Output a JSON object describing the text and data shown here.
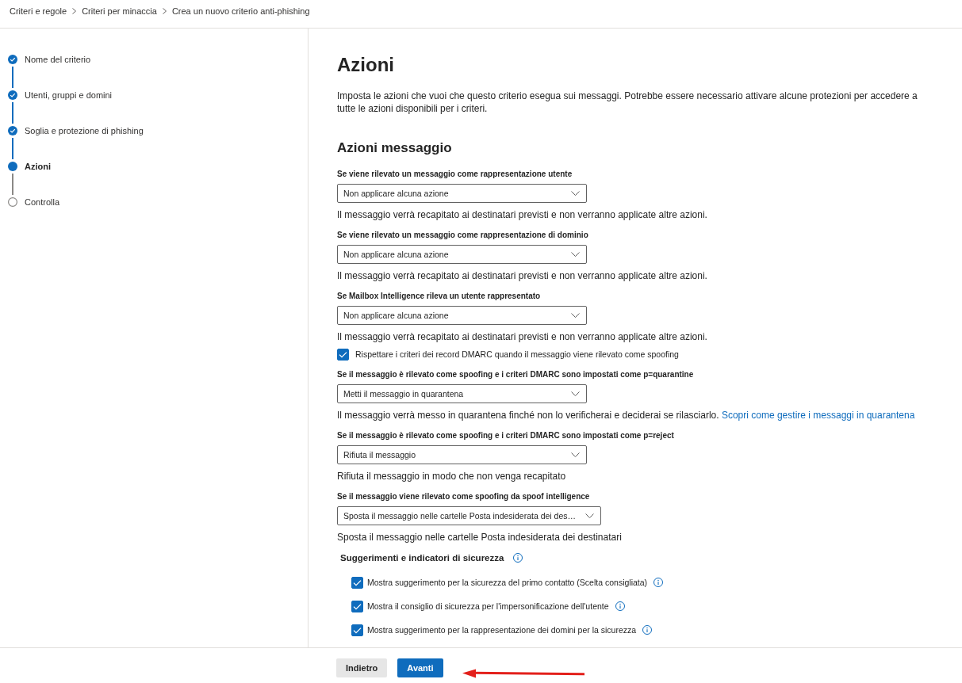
{
  "breadcrumb": [
    "Criteri e regole",
    "Criteri per minaccia",
    "Crea un nuovo criterio anti-phishing"
  ],
  "steps": [
    {
      "label": "Nome del criterio",
      "completed": true,
      "selected": false
    },
    {
      "label": "Utenti, gruppi e domini",
      "completed": true,
      "selected": false
    },
    {
      "label": "Soglia e protezione di phishing",
      "completed": true,
      "selected": false
    },
    {
      "label": "Azioni",
      "completed": false,
      "selected": true
    },
    {
      "label": "Controlla",
      "completed": false,
      "selected": false
    }
  ],
  "page": {
    "title": "Azioni",
    "description": "Imposta le azioni che vuoi che questo criterio esegua sui messaggi. Potrebbe essere necessario attivare alcune protezioni per accedere a tutte le azioni disponibili per i criteri."
  },
  "message_actions": {
    "title": "Azioni messaggio",
    "items": [
      {
        "kind": "dropdown",
        "label": "Se viene rilevato un messaggio come rappresentazione utente",
        "value": "Non applicare alcuna azione",
        "help": "Il messaggio verrà recapitato ai destinatari previsti e non verranno applicate altre azioni."
      },
      {
        "kind": "dropdown",
        "label": "Se viene rilevato un messaggio come rappresentazione di dominio",
        "value": "Non applicare alcuna azione",
        "help": "Il messaggio verrà recapitato ai destinatari previsti e non verranno applicate altre azioni."
      },
      {
        "kind": "dropdown",
        "label": "Se Mailbox Intelligence rileva un utente rappresentato",
        "value": "Non applicare alcuna azione",
        "help": "Il messaggio verrà recapitato ai destinatari previsti e non verranno applicate altre azioni."
      },
      {
        "kind": "checkbox",
        "label": "Rispettare i criteri dei record DMARC quando il messaggio viene rilevato come spoofing",
        "checked": true
      },
      {
        "kind": "dropdown",
        "label": "Se il messaggio è rilevato come spoofing e i criteri DMARC sono impostati come p=quarantine",
        "value": "Metti il messaggio in quarantena",
        "help": "Il messaggio verrà messo in quarantena finché non lo verificherai e deciderai se rilasciarlo.",
        "link": "Scopri come gestire i messaggi in quarantena"
      },
      {
        "kind": "dropdown",
        "label": "Se il messaggio è rilevato come spoofing e i criteri DMARC sono impostati come p=reject",
        "value": "Rifiuta il messaggio",
        "help": "Rifiuta il messaggio in modo che non venga recapitato"
      },
      {
        "kind": "dropdown",
        "label": "Se il messaggio viene rilevato come spoofing da spoof intelligence",
        "value": "Sposta il messaggio nelle cartelle Posta indesiderata dei des…",
        "help": "Sposta il messaggio nelle cartelle Posta indesiderata dei destinatari"
      }
    ]
  },
  "safety_tips": {
    "title": "Suggerimenti e indicatori di sicurezza",
    "items": [
      {
        "label": "Mostra suggerimento per la sicurezza del primo contatto (Scelta consigliata)",
        "checked": true
      },
      {
        "label": "Mostra il consiglio di sicurezza per l'impersonificazione dell'utente",
        "checked": true
      },
      {
        "label": "Mostra suggerimento per la rappresentazione dei domini per la sicurezza",
        "checked": true
      }
    ]
  },
  "footer": {
    "buttons": [
      {
        "label": "Indietro",
        "kind": "secondary"
      },
      {
        "label": "Avanti",
        "kind": "primary"
      }
    ]
  }
}
